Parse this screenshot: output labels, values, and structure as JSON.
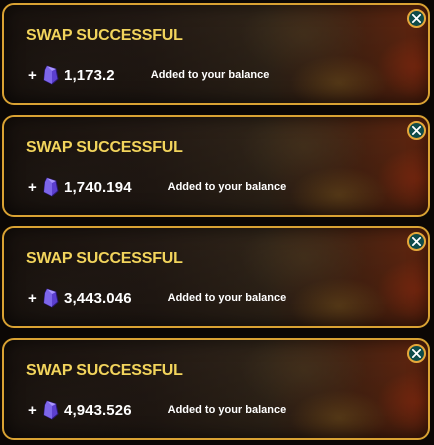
{
  "notifications": [
    {
      "title": "SWAP SUCCESSFUL",
      "prefix": "+",
      "amount": "1,173.2",
      "message": "Added to your balance",
      "icon": "purple-gem-icon",
      "close_icon": "close-icon"
    },
    {
      "title": "SWAP SUCCESSFUL",
      "prefix": "+",
      "amount": "1,740.194",
      "message": "Added to your balance",
      "icon": "purple-gem-icon",
      "close_icon": "close-icon"
    },
    {
      "title": "SWAP SUCCESSFUL",
      "prefix": "+",
      "amount": "3,443.046",
      "message": "Added to your balance",
      "icon": "purple-gem-icon",
      "close_icon": "close-icon"
    },
    {
      "title": "SWAP SUCCESSFUL",
      "prefix": "+",
      "amount": "4,943.526",
      "message": "Added to your balance",
      "icon": "purple-gem-icon",
      "close_icon": "close-icon"
    }
  ],
  "colors": {
    "title": "#f2d45c",
    "border": "#d9a233",
    "close_bg": "#0e4b4a",
    "gem": "#6a4fd8"
  }
}
